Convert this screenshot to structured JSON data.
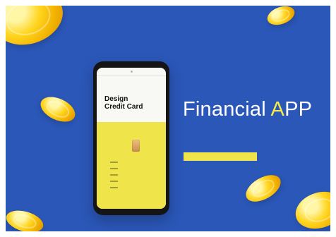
{
  "screen": {
    "background_color": "#2b57b8",
    "accent_color": "#efe54a"
  },
  "hero": {
    "title_prefix": "Financial ",
    "title_accent": "A",
    "title_suffix": "PP",
    "subtitle_line_1": "",
    "subtitle_line_2": "",
    "cta_label": ""
  },
  "phone": {
    "status_left": "",
    "status_right": "",
    "card_title_line_1": "Design",
    "card_title_line_2": "Credit Card",
    "card_brand": ""
  }
}
